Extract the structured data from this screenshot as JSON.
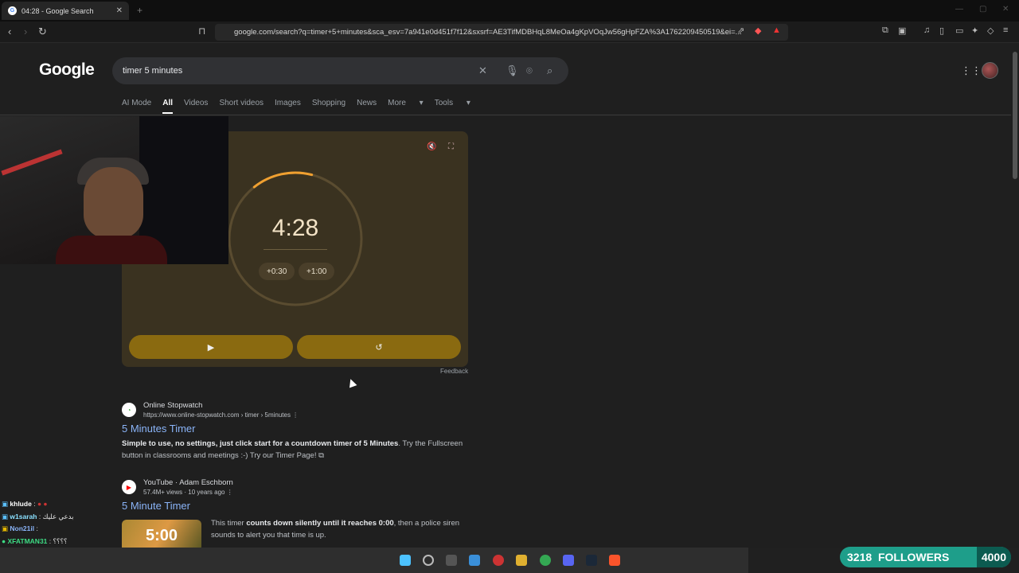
{
  "browser": {
    "tab_title": "04:28 - Google Search",
    "new_tab": "+",
    "url": "google.com/search?q=timer+5+minutes&sca_esv=7a941e0d451f7f12&sxsrf=AE3TifMDBHqL8MeOa4gKpVOqJw56gHpFZA%3A1762209450519&ei=..."
  },
  "google": {
    "logo": "Google",
    "query": "timer 5 minutes",
    "tabs": [
      "AI Mode",
      "All",
      "Videos",
      "Short videos",
      "Images",
      "Shopping",
      "News",
      "More",
      "Tools"
    ],
    "active_tab": "All"
  },
  "timer": {
    "time": "4:28",
    "progress_remaining": 0.893,
    "add_30": "+0:30",
    "add_60": "+1:00",
    "start_icon": "play-icon",
    "reset_icon": "reset-icon",
    "feedback": "Feedback",
    "accent_color": "#f0a030"
  },
  "results": [
    {
      "source": "Online Stopwatch",
      "url": "https://www.online-stopwatch.com › timer › 5minutes",
      "title": "5 Minutes Timer",
      "snippet_bold": "Simple to use, no settings, just click start for a countdown timer of 5 Minutes",
      "snippet_rest": ". Try the Fullscreen button in classrooms and meetings :-) Try our Timer Page!"
    },
    {
      "source": "YouTube · Adam Eschborn",
      "meta": "57.4M+ views · 10 years ago",
      "title": "5 Minute Timer",
      "snippet_pre": "This timer ",
      "snippet_bold": "counts down silently until it reaches 0:00",
      "snippet_rest": ", then a police siren sounds to alert you that time is up.",
      "thumb_text": "5:00"
    }
  ],
  "chat": [
    {
      "user": "khlude",
      "msg": ":",
      "color": "#ffffff"
    },
    {
      "user": "w1sarah",
      "msg": ": بدعي عليك",
      "color": "#8ae0ff"
    },
    {
      "user": "Non21il",
      "msg": ":",
      "color": "#8ab4f8"
    },
    {
      "user": "XFATMAN31",
      "msg": ": ؟؟؟؟",
      "color": "#3ddc84"
    }
  ],
  "stream": {
    "followers_count": "3218",
    "followers_label": "FOLLOWERS",
    "followers_goal": "4000"
  }
}
